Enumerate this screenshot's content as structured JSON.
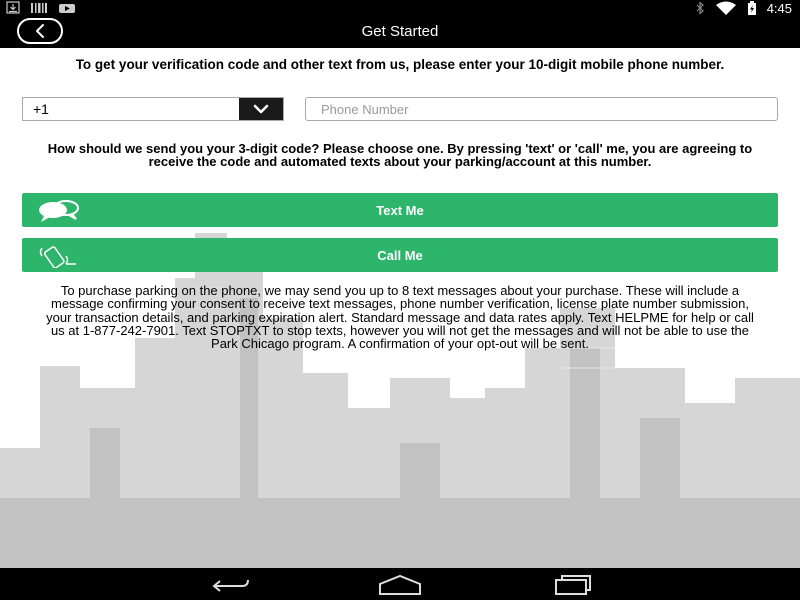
{
  "status_bar": {
    "time": "4:45",
    "icons": [
      "download-icon",
      "barcode-icon",
      "video-icon",
      "bluetooth-icon",
      "wifi-icon",
      "battery-charging-icon"
    ]
  },
  "header": {
    "title": "Get Started",
    "back_icon": "chevron-left-icon"
  },
  "intro_text": "To get your verification code and other text from us, please enter your 10-digit mobile phone number.",
  "country_select": {
    "value": "+1",
    "icon": "chevron-down-icon"
  },
  "phone_field": {
    "placeholder": "Phone Number",
    "value": ""
  },
  "prompt_text": "How should we send you your 3-digit code? Please choose one.  By pressing 'text' or 'call' me, you are agreeing to receive the code and automated texts about your parking/account at this number.",
  "buttons": {
    "text_me": {
      "label": "Text Me",
      "icon": "chat-bubbles-icon"
    },
    "call_me": {
      "label": "Call Me",
      "icon": "phone-ringing-icon"
    }
  },
  "disclaimer_text": "To purchase parking on the phone, we may send you up to 8 text messages about your purchase. These will include a message confirming your consent to receive text messages, phone number verification, license plate number submission, your transaction details, and parking expiration alert. Standard message and data rates apply.  Text HELPME for help or call us at 1-877-242-7901. Text STOPTXT to stop texts, however you will not get the messages and will not be able to use the Park Chicago program. A confirmation of your opt-out will be sent.",
  "nav_bar": {
    "icons": [
      "back-icon",
      "home-icon",
      "recents-icon"
    ]
  },
  "colors": {
    "accent_green": "#2db56b",
    "header_bg": "#000000",
    "skyline_gray": "#cfcfcf"
  }
}
